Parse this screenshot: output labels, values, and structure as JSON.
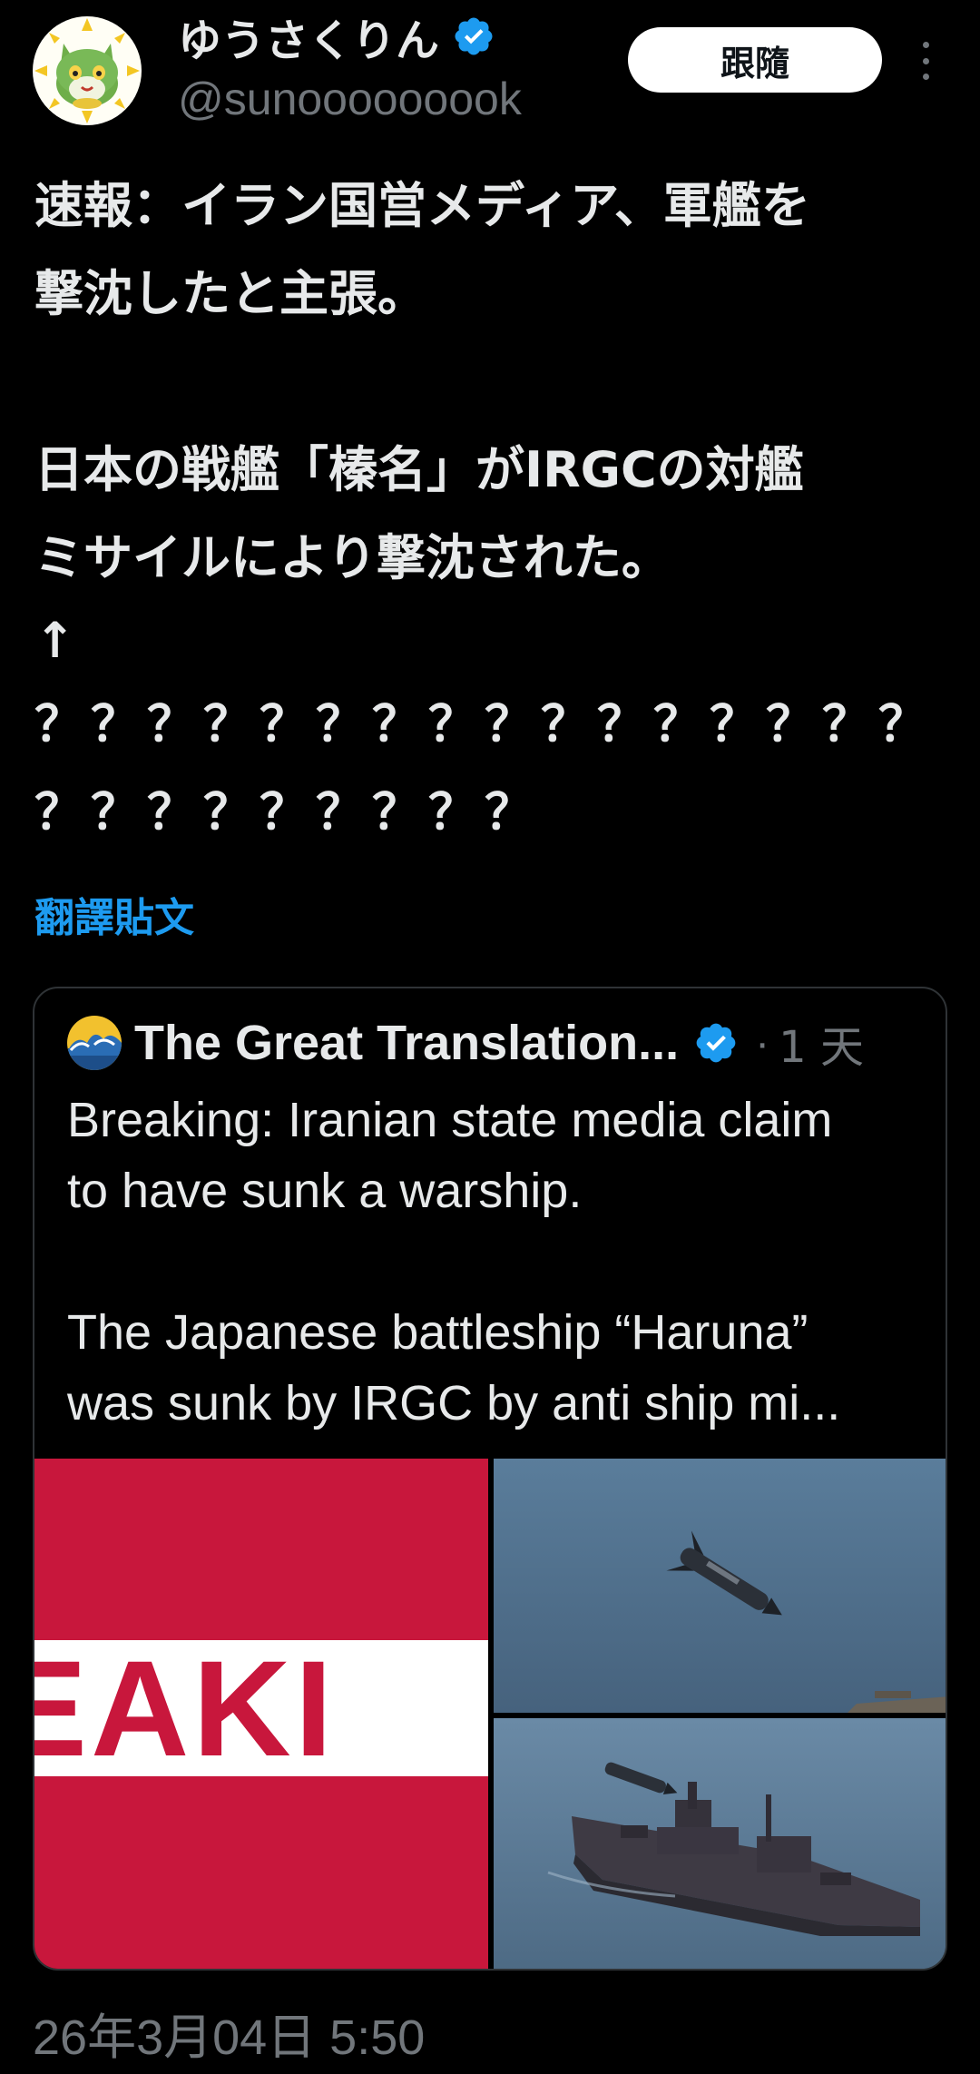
{
  "author": {
    "display_name": "ゆうさくりん",
    "handle": "@sunooooooook",
    "verified": true,
    "follow_label": "跟隨"
  },
  "tweet": {
    "lines": [
      "速報：イラン国営メディア、軍艦を",
      "撃沈したと主張。",
      "",
      "日本の戦艦「榛名」がIRGCの対艦",
      "ミサイルにより撃沈された。",
      "↑"
    ],
    "question_lines": [
      "？？？？？？？？？？？？？？？？",
      "？？？？？？？？？"
    ],
    "translate_label": "翻譯貼文"
  },
  "quote": {
    "display_name": "The Great Translation...",
    "verified": true,
    "separator": "·",
    "time_ago": "1 天",
    "lines": [
      "Breaking: Iranian state media claim",
      "to have sunk a warship.",
      "",
      "The Japanese battleship “Haruna”",
      "was sunk by IRGC by anti ship mi..."
    ],
    "media": {
      "left_image_text": "EAKI"
    }
  },
  "timestamp": "26年3月04日 5:50",
  "colors": {
    "background": "#000000",
    "text_primary": "#e7e9ea",
    "text_secondary": "#71767b",
    "accent": "#1d9bf0",
    "border": "#2f3336",
    "breaking_red": "#c8173c"
  },
  "icons": {
    "verified": "verified-badge-icon",
    "more": "more-vertical-icon"
  }
}
